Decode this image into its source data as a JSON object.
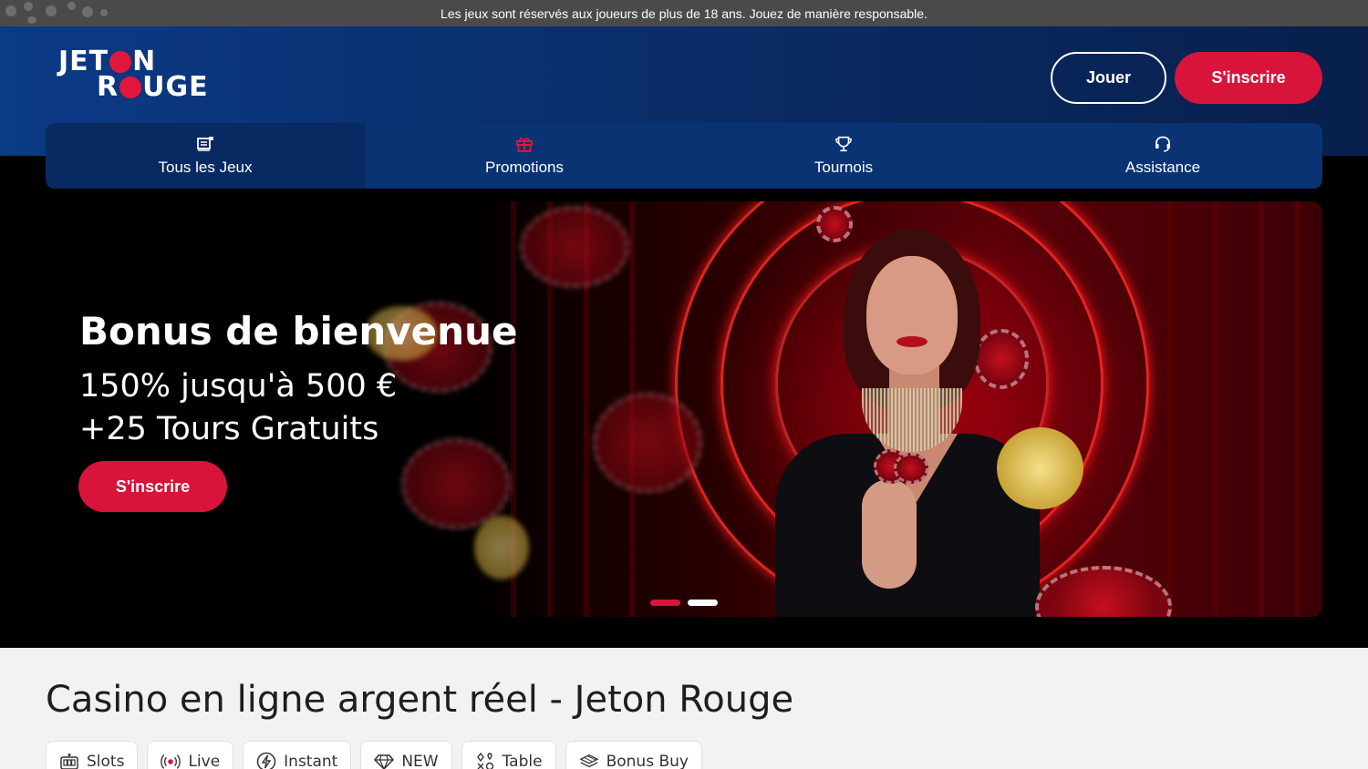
{
  "topbar": {
    "notice": "Les jeux sont réservés aux joueurs de plus de 18 ans. Jouez de manière responsable."
  },
  "logo": {
    "line1_a": "JET",
    "line1_b": "N",
    "line2_a": "R",
    "line2_b": "UGE"
  },
  "header": {
    "play_label": "Jouer",
    "signup_label": "S'inscrire"
  },
  "nav": {
    "items": [
      {
        "label": "Tous les Jeux",
        "icon": "games-icon",
        "active": true
      },
      {
        "label": "Promotions",
        "icon": "gift-icon"
      },
      {
        "label": "Tournois",
        "icon": "trophy-icon"
      },
      {
        "label": "Assistance",
        "icon": "headset-icon"
      }
    ]
  },
  "hero": {
    "title": "Bonus de bienvenue",
    "line1": "150% jusqu'à 500 €",
    "line2": "+25 Tours Gratuits",
    "cta": "S'inscrire",
    "slides": 2,
    "active_slide": 1
  },
  "content": {
    "title": "Casino en ligne argent réel - Jeton Rouge",
    "categories": [
      {
        "label": "Slots",
        "icon": "slots-icon"
      },
      {
        "label": "Live",
        "icon": "live-icon"
      },
      {
        "label": "Instant",
        "icon": "lightning-icon"
      },
      {
        "label": "NEW",
        "icon": "diamond-icon"
      },
      {
        "label": "Table",
        "icon": "cards-icon"
      },
      {
        "label": "Bonus Buy",
        "icon": "bonus-buy-icon"
      }
    ]
  },
  "colors": {
    "brand_red": "#d8143a",
    "header_blue": "#0a3374",
    "topbar": "#4a4a4a"
  }
}
